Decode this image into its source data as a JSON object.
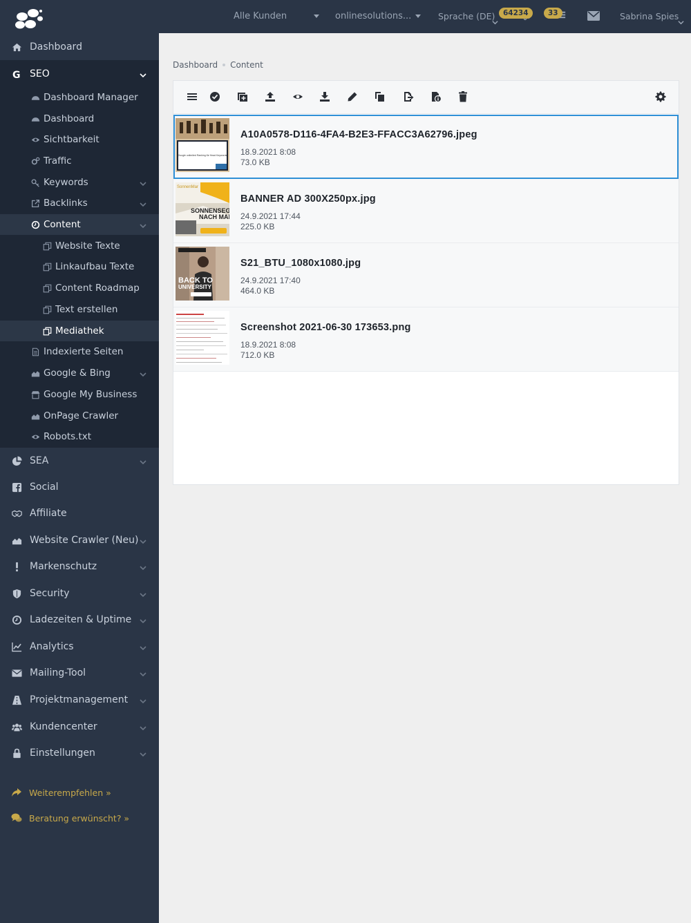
{
  "topbar": {
    "customer_select": "Alle Kunden",
    "project_select": "onlinesolutions...",
    "language": "Sprache (DE)",
    "notifications_count": "64234",
    "tasks_count": "33",
    "user_name": "Sabrina Spies"
  },
  "sidebar": {
    "dashboard": "Dashboard",
    "seo": "SEO",
    "seo_items": {
      "dashboard_manager": "Dashboard Manager",
      "dashboard": "Dashboard",
      "sichtbarkeit": "Sichtbarkeit",
      "traffic": "Traffic",
      "keywords": "Keywords",
      "backlinks": "Backlinks",
      "content": "Content",
      "content_items": {
        "website_texte": "Website Texte",
        "linkaufbau_texte": "Linkaufbau Texte",
        "content_roadmap": "Content Roadmap",
        "text_erstellen": "Text erstellen",
        "mediathek": "Mediathek"
      },
      "indexierte_seiten": "Indexierte Seiten",
      "google_bing": "Google & Bing",
      "google_my_business": "Google My Business",
      "onpage_crawler": "OnPage Crawler",
      "robots": "Robots.txt"
    },
    "sea": "SEA",
    "social": "Social",
    "affiliate": "Affiliate",
    "website_crawler": "Website Crawler (Neu)",
    "markenschutz": "Markenschutz",
    "security": "Security",
    "ladezeiten": "Ladezeiten & Uptime",
    "analytics": "Analytics",
    "mailing": "Mailing-Tool",
    "projektmanagement": "Projektmanagement",
    "kundencenter": "Kundencenter",
    "einstellungen": "Einstellungen",
    "weiterempfehlen": "Weiterempfehlen »",
    "beratung": "Beratung erwünscht? »"
  },
  "breadcrumb": [
    "Dashboard",
    "Content"
  ],
  "files": [
    {
      "name": "A10A0578-D116-4FA4-B2E3-FFACC3A62796.jpeg",
      "date": "18.9.2021 8:08",
      "size": "73.0 KB"
    },
    {
      "name": "BANNER AD 300X250px.jpg",
      "date": "24.9.2021 17:44",
      "size": "225.0 KB"
    },
    {
      "name": "S21_BTU_1080x1080.jpg",
      "date": "24.9.2021 17:40",
      "size": "464.0 KB"
    },
    {
      "name": "Screenshot 2021-06-30 173653.png",
      "date": "18.9.2021 8:08",
      "size": "712.0 KB"
    }
  ],
  "thumb_text": {
    "t1_caption": "Google unlimited Ranking für Head Keywords",
    "t2_brand": "SonnenMar",
    "t2_line1": "SONNENSEGE",
    "t2_line2": "NACH MAI",
    "t3_line1": "BACK TO",
    "t3_line2": "UNIVERSITY"
  },
  "colors": {
    "sidebar_bg": "#2a3546",
    "sidebar_sub_bg": "#1e2735",
    "accent_gold": "#c8a94a",
    "selected_border": "#2e8fd6"
  }
}
